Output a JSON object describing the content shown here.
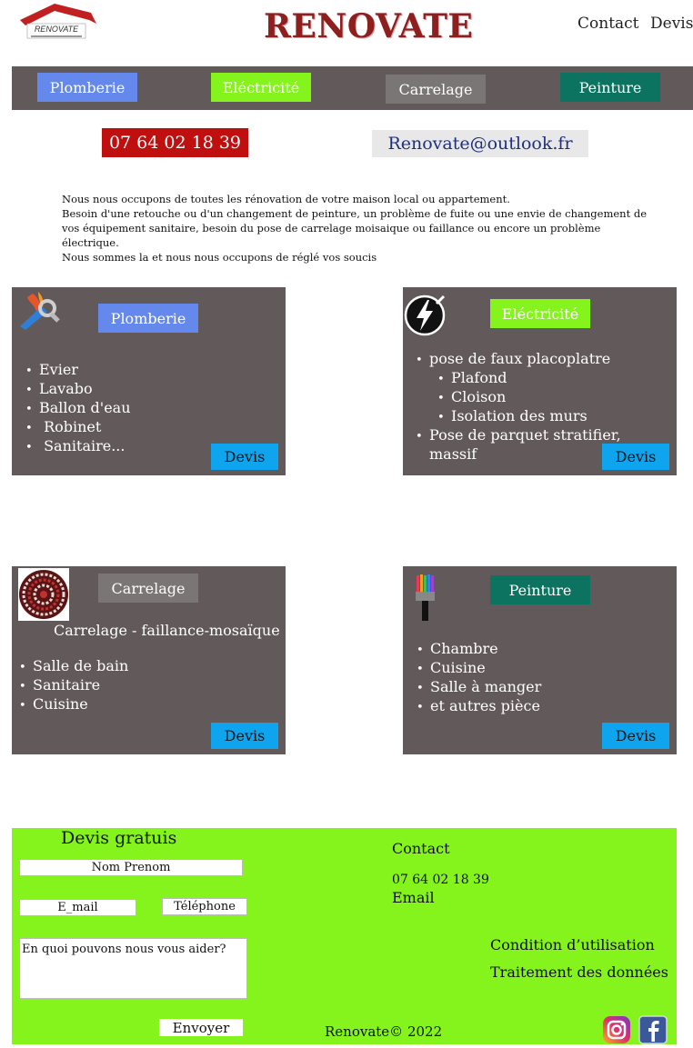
{
  "header": {
    "logo_text": "RENOVATE",
    "brand": "RENOVATE",
    "links": [
      "Contact",
      "Devis"
    ]
  },
  "nav": [
    {
      "label": "Plomberie",
      "color": "#6488ec"
    },
    {
      "label": "Eléctricité",
      "color": "#84f41c"
    },
    {
      "label": "Carrelage",
      "color": "#7a7676"
    },
    {
      "label": "Peinture",
      "color": "#0b7360"
    }
  ],
  "contact_bar": {
    "phone": "07 64 02 18 39",
    "email": "Renovate@outlook.fr"
  },
  "intro": [
    "Nous nous occupons de toutes les rénovation de votre maison local ou appartement.",
    "Besoin d'une retouche ou d'un changement de peinture, un problème de fuite ou une envie de changement de vos équipement sanitaire, besoin du pose de  carrelage moisaique ou faillance ou encore un problème électrique.",
    "Nous sommes la et nous nous occupons de réglé vos soucis"
  ],
  "cards": {
    "plomberie": {
      "title": "Plomberie",
      "items": [
        "Evier",
        "Lavabo",
        "Ballon d'eau",
        " Robinet",
        " Sanitaire..."
      ],
      "devis": "Devis",
      "icon": "plumbing-icon"
    },
    "electricite": {
      "title": "Eléctricité",
      "items": [
        "pose de faux placoplatre",
        "Plafond",
        "Cloison",
        "Isolation des murs",
        "Pose de parquet stratifier,",
        "massif"
      ],
      "devis": "Devis",
      "icon": "electric-plug-icon"
    },
    "carrelage": {
      "title": "Carrelage",
      "subtitle": "Carrelage - faillance-mosaïque",
      "items": [
        "Salle de bain",
        "Sanitaire",
        "Cuisine"
      ],
      "devis": "Devis",
      "icon": "mosaic-tile-icon"
    },
    "peinture": {
      "title": "Peinture",
      "items": [
        "Chambre",
        "Cuisine",
        "Salle à manger",
        "et autres pièce"
      ],
      "devis": "Devis",
      "icon": "paint-brush-icon"
    }
  },
  "footer": {
    "form_title": "Devis gratuis",
    "name_placeholder": "Nom Prenom",
    "email_placeholder": "E_mail",
    "phone_placeholder": "Téléphone",
    "message_placeholder": "En quoi pouvons nous vous aider?",
    "submit": "Envoyer",
    "contact_title": "Contact",
    "contact_phone": "07 64 02 18 39",
    "contact_email": "Email",
    "terms": "Condition d’utilisation",
    "privacy": "Traitement des données",
    "copyright": "Renovate© 2022",
    "social": [
      "instagram-icon",
      "facebook-icon"
    ]
  }
}
